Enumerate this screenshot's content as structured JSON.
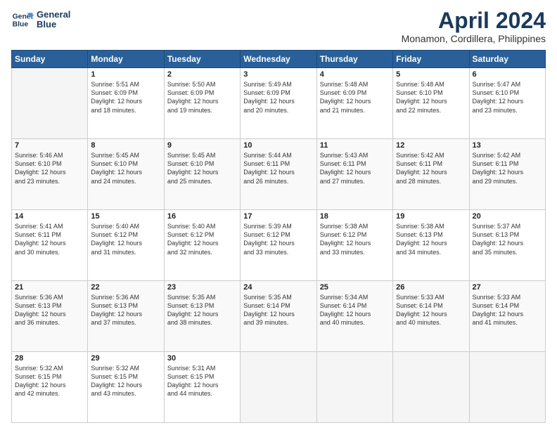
{
  "header": {
    "logo_line1": "General",
    "logo_line2": "Blue",
    "title": "April 2024",
    "subtitle": "Monamon, Cordillera, Philippines"
  },
  "days_of_week": [
    "Sunday",
    "Monday",
    "Tuesday",
    "Wednesday",
    "Thursday",
    "Friday",
    "Saturday"
  ],
  "weeks": [
    [
      {
        "day": "",
        "info": ""
      },
      {
        "day": "1",
        "info": "Sunrise: 5:51 AM\nSunset: 6:09 PM\nDaylight: 12 hours\nand 18 minutes."
      },
      {
        "day": "2",
        "info": "Sunrise: 5:50 AM\nSunset: 6:09 PM\nDaylight: 12 hours\nand 19 minutes."
      },
      {
        "day": "3",
        "info": "Sunrise: 5:49 AM\nSunset: 6:09 PM\nDaylight: 12 hours\nand 20 minutes."
      },
      {
        "day": "4",
        "info": "Sunrise: 5:48 AM\nSunset: 6:09 PM\nDaylight: 12 hours\nand 21 minutes."
      },
      {
        "day": "5",
        "info": "Sunrise: 5:48 AM\nSunset: 6:10 PM\nDaylight: 12 hours\nand 22 minutes."
      },
      {
        "day": "6",
        "info": "Sunrise: 5:47 AM\nSunset: 6:10 PM\nDaylight: 12 hours\nand 23 minutes."
      }
    ],
    [
      {
        "day": "7",
        "info": "Sunrise: 5:46 AM\nSunset: 6:10 PM\nDaylight: 12 hours\nand 23 minutes."
      },
      {
        "day": "8",
        "info": "Sunrise: 5:45 AM\nSunset: 6:10 PM\nDaylight: 12 hours\nand 24 minutes."
      },
      {
        "day": "9",
        "info": "Sunrise: 5:45 AM\nSunset: 6:10 PM\nDaylight: 12 hours\nand 25 minutes."
      },
      {
        "day": "10",
        "info": "Sunrise: 5:44 AM\nSunset: 6:11 PM\nDaylight: 12 hours\nand 26 minutes."
      },
      {
        "day": "11",
        "info": "Sunrise: 5:43 AM\nSunset: 6:11 PM\nDaylight: 12 hours\nand 27 minutes."
      },
      {
        "day": "12",
        "info": "Sunrise: 5:42 AM\nSunset: 6:11 PM\nDaylight: 12 hours\nand 28 minutes."
      },
      {
        "day": "13",
        "info": "Sunrise: 5:42 AM\nSunset: 6:11 PM\nDaylight: 12 hours\nand 29 minutes."
      }
    ],
    [
      {
        "day": "14",
        "info": "Sunrise: 5:41 AM\nSunset: 6:11 PM\nDaylight: 12 hours\nand 30 minutes."
      },
      {
        "day": "15",
        "info": "Sunrise: 5:40 AM\nSunset: 6:12 PM\nDaylight: 12 hours\nand 31 minutes."
      },
      {
        "day": "16",
        "info": "Sunrise: 5:40 AM\nSunset: 6:12 PM\nDaylight: 12 hours\nand 32 minutes."
      },
      {
        "day": "17",
        "info": "Sunrise: 5:39 AM\nSunset: 6:12 PM\nDaylight: 12 hours\nand 33 minutes."
      },
      {
        "day": "18",
        "info": "Sunrise: 5:38 AM\nSunset: 6:12 PM\nDaylight: 12 hours\nand 33 minutes."
      },
      {
        "day": "19",
        "info": "Sunrise: 5:38 AM\nSunset: 6:13 PM\nDaylight: 12 hours\nand 34 minutes."
      },
      {
        "day": "20",
        "info": "Sunrise: 5:37 AM\nSunset: 6:13 PM\nDaylight: 12 hours\nand 35 minutes."
      }
    ],
    [
      {
        "day": "21",
        "info": "Sunrise: 5:36 AM\nSunset: 6:13 PM\nDaylight: 12 hours\nand 36 minutes."
      },
      {
        "day": "22",
        "info": "Sunrise: 5:36 AM\nSunset: 6:13 PM\nDaylight: 12 hours\nand 37 minutes."
      },
      {
        "day": "23",
        "info": "Sunrise: 5:35 AM\nSunset: 6:13 PM\nDaylight: 12 hours\nand 38 minutes."
      },
      {
        "day": "24",
        "info": "Sunrise: 5:35 AM\nSunset: 6:14 PM\nDaylight: 12 hours\nand 39 minutes."
      },
      {
        "day": "25",
        "info": "Sunrise: 5:34 AM\nSunset: 6:14 PM\nDaylight: 12 hours\nand 40 minutes."
      },
      {
        "day": "26",
        "info": "Sunrise: 5:33 AM\nSunset: 6:14 PM\nDaylight: 12 hours\nand 40 minutes."
      },
      {
        "day": "27",
        "info": "Sunrise: 5:33 AM\nSunset: 6:14 PM\nDaylight: 12 hours\nand 41 minutes."
      }
    ],
    [
      {
        "day": "28",
        "info": "Sunrise: 5:32 AM\nSunset: 6:15 PM\nDaylight: 12 hours\nand 42 minutes."
      },
      {
        "day": "29",
        "info": "Sunrise: 5:32 AM\nSunset: 6:15 PM\nDaylight: 12 hours\nand 43 minutes."
      },
      {
        "day": "30",
        "info": "Sunrise: 5:31 AM\nSunset: 6:15 PM\nDaylight: 12 hours\nand 44 minutes."
      },
      {
        "day": "",
        "info": ""
      },
      {
        "day": "",
        "info": ""
      },
      {
        "day": "",
        "info": ""
      },
      {
        "day": "",
        "info": ""
      }
    ]
  ]
}
